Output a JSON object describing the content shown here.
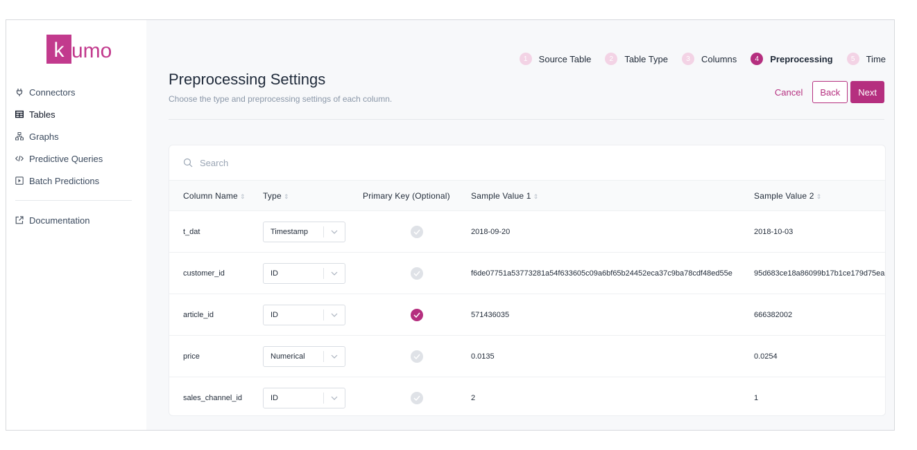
{
  "logo": {
    "box_text": "k",
    "text": "umo",
    "color": "#c23a8d"
  },
  "sidebar": {
    "items": [
      {
        "label": "Connectors",
        "icon": "plug-icon"
      },
      {
        "label": "Tables",
        "icon": "table-icon"
      },
      {
        "label": "Graphs",
        "icon": "graph-icon"
      },
      {
        "label": "Predictive Queries",
        "icon": "code-icon"
      },
      {
        "label": "Batch Predictions",
        "icon": "play-square-icon"
      }
    ],
    "docs": {
      "label": "Documentation",
      "icon": "external-link-icon"
    }
  },
  "stepper": {
    "steps": [
      {
        "num": "1",
        "label": "Source Table"
      },
      {
        "num": "2",
        "label": "Table Type"
      },
      {
        "num": "3",
        "label": "Columns"
      },
      {
        "num": "4",
        "label": "Preprocessing"
      },
      {
        "num": "5",
        "label": "Time"
      }
    ],
    "current": "4"
  },
  "header": {
    "title": "Preprocessing Settings",
    "subtitle": "Choose the type and preprocessing settings of each column."
  },
  "actions": {
    "cancel": "Cancel",
    "back": "Back",
    "next": "Next"
  },
  "search": {
    "placeholder": "Search"
  },
  "table": {
    "headers": [
      "Column Name",
      "Type",
      "Primary Key (Optional)",
      "Sample Value 1",
      "Sample Value 2"
    ],
    "rows": [
      {
        "name": "t_dat",
        "type": "Timestamp",
        "pk": false,
        "s1": "2018-09-20",
        "s2": "2018-10-03"
      },
      {
        "name": "customer_id",
        "type": "ID",
        "pk": false,
        "s1": "f6de07751a53773281a54f633605c09a6bf65b24452eca37c9ba78cdf48ed55e",
        "s2": "95d683ce18a86099b17b1ce179d75ea"
      },
      {
        "name": "article_id",
        "type": "ID",
        "pk": true,
        "s1": "571436035",
        "s2": "666382002"
      },
      {
        "name": "price",
        "type": "Numerical",
        "pk": false,
        "s1": "0.0135",
        "s2": "0.0254"
      },
      {
        "name": "sales_channel_id",
        "type": "ID",
        "pk": false,
        "s1": "2",
        "s2": "1"
      }
    ]
  },
  "colors": {
    "accent": "#b52f7f",
    "accent_light": "#f3d3e5"
  }
}
